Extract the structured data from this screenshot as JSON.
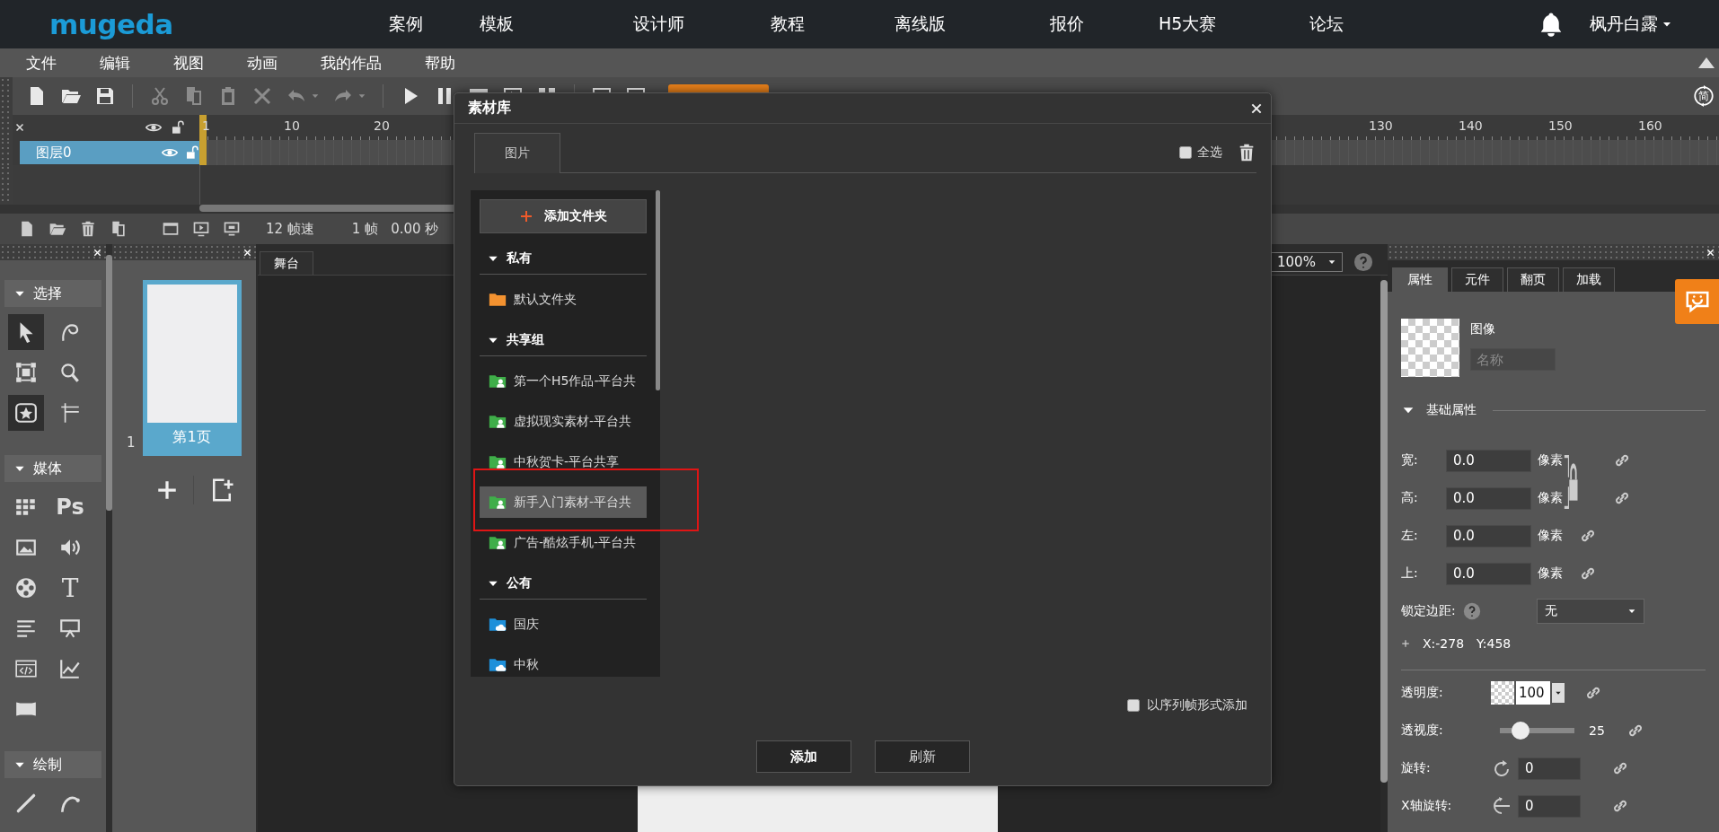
{
  "top_nav": {
    "logo": "mugeda",
    "links": [
      "案例",
      "模板",
      "设计师",
      "教程",
      "离线版",
      "报价",
      "H5大赛",
      "论坛"
    ],
    "user": "枫丹白露"
  },
  "menu_bar": [
    "文件",
    "编辑",
    "视图",
    "动画",
    "我的作品",
    "帮助"
  ],
  "toolbar": {
    "buttons": [
      {
        "disabled": false
      },
      {
        "disabled": false
      },
      {
        "disabled": false
      },
      {
        "disabled": true
      },
      {
        "disabled": true
      },
      {
        "disabled": true
      },
      {
        "disabled": true
      },
      {
        "disabled": true
      },
      {
        "disabled": true
      },
      {
        "disabled": false
      },
      {
        "disabled": false
      },
      {
        "disabled": false
      },
      {
        "disabled": false
      },
      {
        "disabled": false
      },
      {
        "disabled": false
      },
      {
        "disabled": false
      }
    ],
    "mode_toggle": "简"
  },
  "timeline": {
    "ruler": [
      "1",
      "10",
      "20",
      "130",
      "140",
      "150",
      "160"
    ],
    "layers": [
      {
        "name": "图层0",
        "selected": true
      }
    ],
    "fps": "12",
    "fps_label": "帧速",
    "frame": "1",
    "frame_label": "帧",
    "time": "0.00",
    "time_label": "秒"
  },
  "tool_panel": {
    "sections": [
      {
        "title": "选择",
        "expanded": true,
        "tools": [
          {
            "selected": true
          },
          {
            "selected": false
          },
          {
            "selected": false
          },
          {
            "selected": false
          },
          {
            "selected": true
          },
          {
            "selected": false
          }
        ]
      },
      {
        "title": "媒体",
        "expanded": true,
        "tools": [
          {
            "selected": false
          },
          {
            "label": "Ps",
            "selected": false
          },
          {
            "selected": false
          },
          {
            "selected": false
          },
          {
            "selected": false
          },
          {
            "label": "T",
            "selected": false
          },
          {
            "selected": false
          },
          {
            "selected": false
          },
          {
            "selected": false
          },
          {
            "selected": false
          },
          {
            "selected": false
          }
        ]
      },
      {
        "title": "绘制",
        "expanded": true,
        "tools": [
          {
            "selected": false
          },
          {
            "selected": false
          }
        ]
      }
    ]
  },
  "pages": [
    {
      "number": "1",
      "label": "第1页",
      "selected": true
    }
  ],
  "stage": {
    "tab": "舞台",
    "zoom": "100%"
  },
  "properties": {
    "tabs": [
      {
        "label": "属性",
        "selected": true
      },
      {
        "label": "元件",
        "selected": false
      },
      {
        "label": "翻页",
        "selected": false
      },
      {
        "label": "加载",
        "selected": false
      }
    ],
    "element_type": "图像",
    "name_placeholder": "名称",
    "section": {
      "title": "基础属性",
      "expanded": true
    },
    "size_fields": [
      {
        "label": "宽:",
        "value": "0.0",
        "unit": "像素"
      },
      {
        "label": "高:",
        "value": "0.0",
        "unit": "像素"
      }
    ],
    "position_fields": [
      {
        "label": "左:",
        "value": "0.0",
        "unit": "像素"
      },
      {
        "label": "上:",
        "value": "0.0",
        "unit": "像素"
      }
    ],
    "lock_margin": {
      "label": "锁定边距:",
      "value": "无"
    },
    "coords": {
      "x": "X:-278",
      "y": "Y:458"
    },
    "opacity": {
      "label": "透明度:",
      "value": "100"
    },
    "perspective": {
      "label": "透视度:",
      "level": 0.28,
      "reading": "25"
    },
    "rotation": {
      "label": "旋转:",
      "value": "0"
    },
    "x_rotation": {
      "label": "X轴旋转:",
      "value": "0"
    }
  },
  "dialog": {
    "title": "素材库",
    "tabs": [
      {
        "label": "图片",
        "selected": true
      }
    ],
    "select_all": {
      "label": "全选",
      "checked": false
    },
    "add_folder": "添加文件夹",
    "groups": [
      {
        "title": "私有",
        "expanded": true,
        "folders": [
          {
            "name": "默认文件夹",
            "kind": "private",
            "selected": false
          }
        ]
      },
      {
        "title": "共享组",
        "expanded": true,
        "folders": [
          {
            "name": "第一个H5作品-平台共",
            "kind": "shared",
            "selected": false
          },
          {
            "name": "虚拟现实素材-平台共",
            "kind": "shared",
            "selected": false
          },
          {
            "name": "中秋贺卡-平台共享",
            "kind": "shared",
            "selected": false
          },
          {
            "name": "新手入门素材-平台共",
            "kind": "shared",
            "selected": true
          },
          {
            "name": "广告-酷炫手机-平台共",
            "kind": "shared",
            "selected": false
          }
        ]
      },
      {
        "title": "公有",
        "expanded": true,
        "folders": [
          {
            "name": "国庆",
            "kind": "public",
            "selected": false
          },
          {
            "name": "中秋",
            "kind": "public",
            "selected": false
          }
        ]
      }
    ],
    "sequence_option": {
      "label": "以序列帧形式添加",
      "checked": false
    },
    "buttons": [
      "添加",
      "刷新"
    ]
  }
}
